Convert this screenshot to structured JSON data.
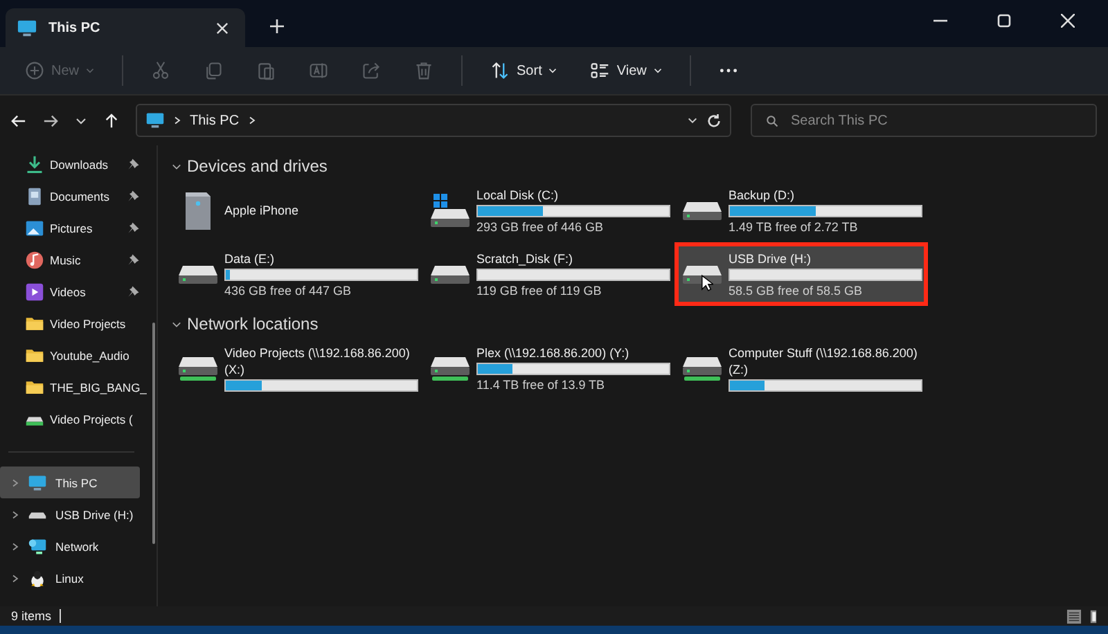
{
  "window": {
    "tab": "This PC"
  },
  "toolbar": [
    {
      "kind": "new",
      "label": "New",
      "disabled": true
    },
    {
      "kind": "cut",
      "disabled": true
    },
    {
      "kind": "copy",
      "disabled": true
    },
    {
      "kind": "paste",
      "disabled": true
    },
    {
      "kind": "rename",
      "disabled": true
    },
    {
      "kind": "share",
      "disabled": true
    },
    {
      "kind": "delete",
      "disabled": true
    },
    {
      "kind": "sort",
      "label": "Sort",
      "disabled": false
    },
    {
      "kind": "view",
      "label": "View",
      "disabled": false
    },
    {
      "kind": "more",
      "disabled": false
    }
  ],
  "address": {
    "path": "This PC"
  },
  "search": {
    "placeholder": "Search This PC"
  },
  "sidebar": {
    "quick_access": [
      {
        "label": "Downloads",
        "kind": "download",
        "pinned": true
      },
      {
        "label": "Documents",
        "kind": "document",
        "pinned": true
      },
      {
        "label": "Pictures",
        "kind": "picture",
        "pinned": true
      },
      {
        "label": "Music",
        "kind": "music",
        "pinned": true
      },
      {
        "label": "Videos",
        "kind": "video",
        "pinned": true
      },
      {
        "label": "Video Projects",
        "kind": "folder",
        "pinned": false
      },
      {
        "label": "Youtube_Audio",
        "kind": "folder",
        "pinned": false
      },
      {
        "label": "THE_BIG_BANG_",
        "kind": "folder",
        "pinned": false
      },
      {
        "label": "Video Projects (",
        "kind": "netdrive",
        "pinned": false
      }
    ],
    "tree": [
      {
        "label": "This PC",
        "kind": "pc",
        "selected": true
      },
      {
        "label": "USB Drive (H:)",
        "kind": "usb",
        "selected": false
      },
      {
        "label": "Network",
        "kind": "network",
        "selected": false
      },
      {
        "label": "Linux",
        "kind": "linux",
        "selected": false
      }
    ]
  },
  "sections": [
    {
      "title": "Devices and drives",
      "expanded": true,
      "items": [
        {
          "kind": "phone",
          "name": [
            "Apple iPhone"
          ],
          "selected": false,
          "highlighted": false
        },
        {
          "kind": "system",
          "name": [
            "Local Disk (C:)"
          ],
          "level": 0.34,
          "reading": "293 GB free of 446 GB",
          "selected": false,
          "highlighted": false
        },
        {
          "kind": "disk",
          "name": [
            "Backup (D:)"
          ],
          "level": 0.45,
          "reading": "1.49 TB free of 2.72 TB",
          "selected": false,
          "highlighted": false
        },
        {
          "kind": "disk",
          "name": [
            "Data (E:)"
          ],
          "level": 0.025,
          "reading": "436 GB free of 447 GB",
          "selected": false,
          "highlighted": false
        },
        {
          "kind": "disk",
          "name": [
            "Scratch_Disk (F:)"
          ],
          "level": 0,
          "reading": "119 GB free of 119 GB",
          "selected": false,
          "highlighted": false
        },
        {
          "kind": "disk",
          "name": [
            "USB Drive (H:)"
          ],
          "level": 0,
          "reading": "58.5 GB free of 58.5 GB",
          "selected": true,
          "highlighted": true
        }
      ]
    },
    {
      "title": "Network locations",
      "expanded": true,
      "items": [
        {
          "kind": "network",
          "name": [
            "Video Projects (\\\\192.168.86.200)",
            "(X:)"
          ],
          "level": 0.19,
          "selected": false,
          "highlighted": false
        },
        {
          "kind": "network",
          "name": [
            "Plex (\\\\192.168.86.200) (Y:)"
          ],
          "level": 0.18,
          "reading": "11.4 TB free of 13.9 TB",
          "selected": false,
          "highlighted": false
        },
        {
          "kind": "network",
          "name": [
            "Computer Stuff (\\\\192.168.86.200)",
            "(Z:)"
          ],
          "level": 0.18,
          "selected": false,
          "highlighted": false
        }
      ]
    }
  ],
  "status_bar": {
    "count": "9 items"
  }
}
